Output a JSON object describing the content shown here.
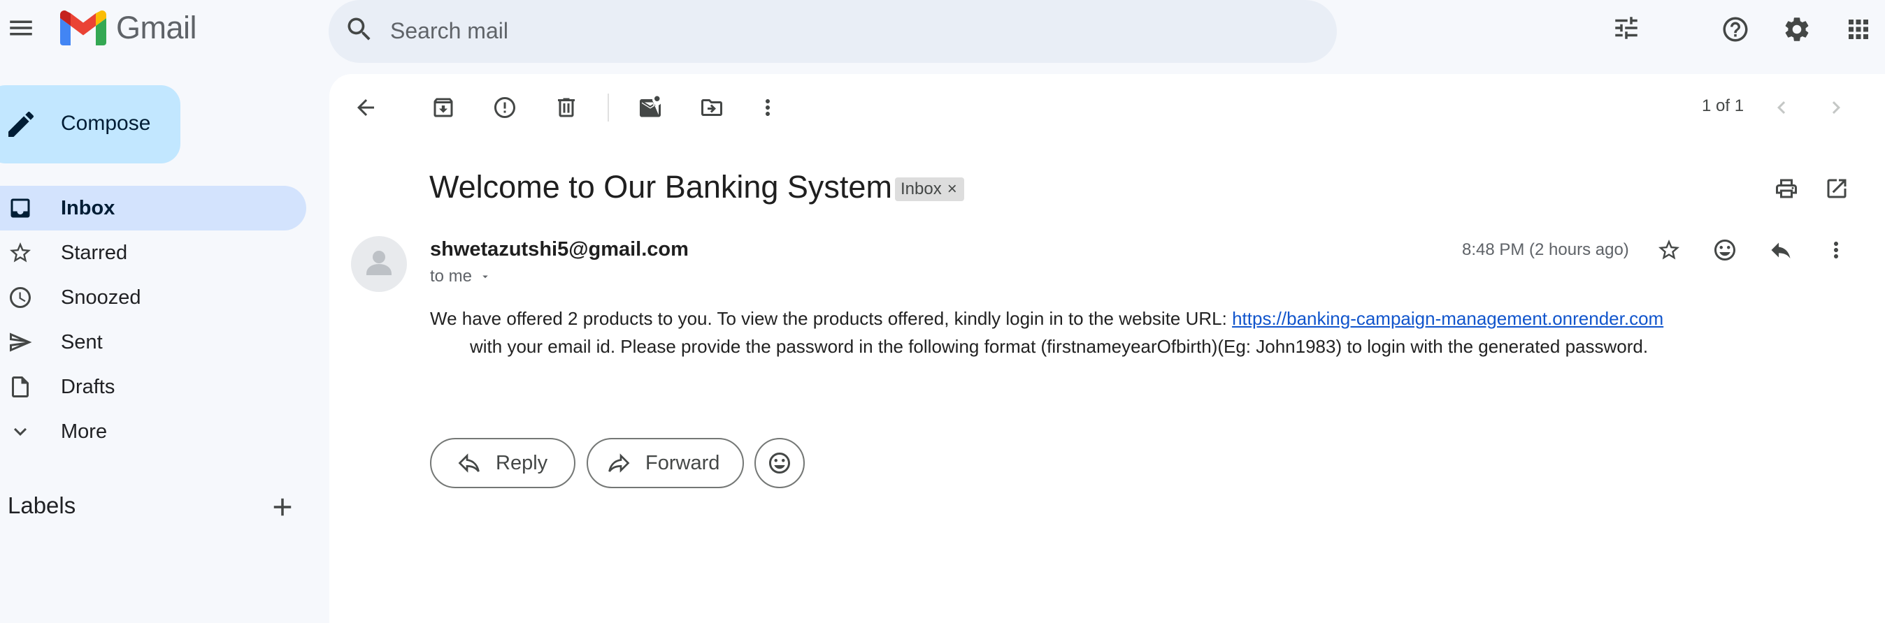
{
  "app": {
    "name": "Gmail"
  },
  "search": {
    "placeholder": "Search mail"
  },
  "sidebar": {
    "compose_label": "Compose",
    "items": [
      {
        "label": "Inbox",
        "icon": "inbox-icon",
        "active": true
      },
      {
        "label": "Starred",
        "icon": "star-icon"
      },
      {
        "label": "Snoozed",
        "icon": "clock-icon"
      },
      {
        "label": "Sent",
        "icon": "send-icon"
      },
      {
        "label": "Drafts",
        "icon": "draft-icon"
      },
      {
        "label": "More",
        "icon": "chevron-down-icon"
      }
    ],
    "labels_heading": "Labels"
  },
  "toolbar": {
    "pager": "1 of 1"
  },
  "email": {
    "subject": "Welcome to Our Banking System",
    "label_chip": "Inbox",
    "chip_close": "×",
    "sender": "shwetazutshi5@gmail.com",
    "recipient": "to me",
    "timestamp": "8:48 PM (2 hours ago)",
    "body_line1": "We have offered 2 products to you. To view the products offered, kindly login in to the website URL: ",
    "body_link": "https://banking-campaign-management.onrender.com",
    "body_line2": "with your email id. Please provide the password in the following format (firstnameyearOfbirth)(Eg: John1983) to login with the generated password."
  },
  "actions": {
    "reply_label": "Reply",
    "forward_label": "Forward"
  },
  "colors": {
    "background": "#f6f8fc",
    "compose": "#c2e7ff",
    "active_nav": "#d3e3fd",
    "search_bg": "#e9eef6",
    "link": "#1155cc"
  }
}
